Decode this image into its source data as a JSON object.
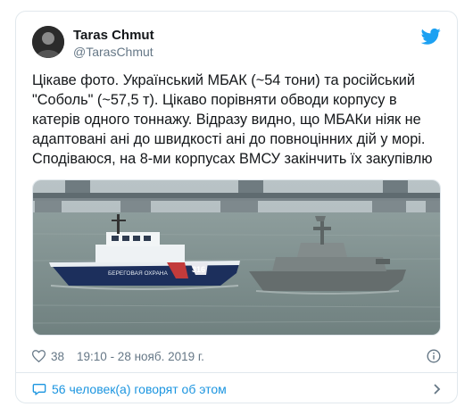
{
  "tweet": {
    "author_name": "Taras Chmut",
    "author_handle": "@TarasChmut",
    "text": "Цікаве фото. Український МБАК (~54 тони) та російський\n\"Соболь\" (~57,5 т). Цікаво порівняти обводи корпусу в\nкатерів одного тоннажу. Відразу видно, що МБАКи ніяк не\nадаптовані ані до швидкості ані до повноцінних дій у морі.\nСподіваюся, на 8-ми корпусах ВМСУ закінчить їх закупівлю",
    "likes": "38",
    "timestamp": "19:10 - 28 нояб. 2019 г.",
    "conversation_label": "56 человек(а) говорят об этом"
  },
  "photo": {
    "boat_label": "БЕРЕГОВАЯ ОХРАНА",
    "hull_number": "316"
  },
  "colors": {
    "accent": "#1da1f2",
    "link": "#1b95e0",
    "muted": "#657786"
  }
}
